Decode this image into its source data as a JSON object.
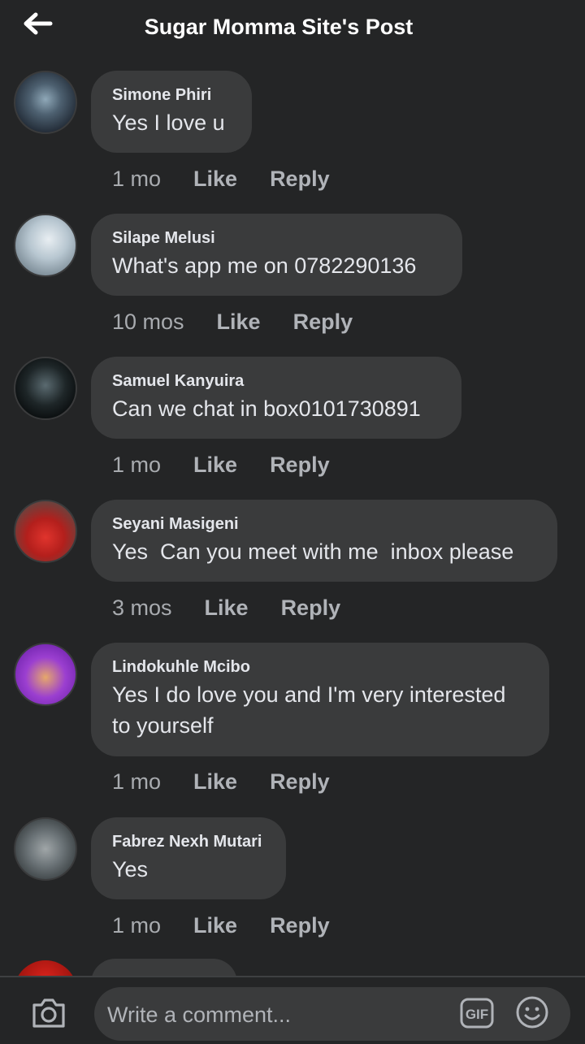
{
  "header": {
    "title": "Sugar Momma Site's Post",
    "back_icon": "arrow-left-icon"
  },
  "comments": [
    {
      "author": "Simone Phiri",
      "text": "Yes I love u",
      "time": "1 mo",
      "like": "Like",
      "reply": "Reply"
    },
    {
      "author": "Silape Melusi",
      "text": "What's app me on 0782290136",
      "time": "10 mos",
      "like": "Like",
      "reply": "Reply"
    },
    {
      "author": "Samuel Kanyuira",
      "text": "Can we chat in box0101730891",
      "time": "1 mo",
      "like": "Like",
      "reply": "Reply"
    },
    {
      "author": "Seyani Masigeni",
      "text": "Yes  Can you meet with me  inbox please",
      "time": "3 mos",
      "like": "Like",
      "reply": "Reply"
    },
    {
      "author": "Lindokuhle Mcibo",
      "text": "Yes I do love you and I'm very interested to yourself",
      "time": "1 mo",
      "like": "Like",
      "reply": "Reply"
    },
    {
      "author": "Fabrez Nexh Mutari",
      "text": "Yes",
      "time": "1 mo",
      "like": "Like",
      "reply": "Reply"
    }
  ],
  "composer": {
    "placeholder": "Write a comment...",
    "camera_icon": "camera-icon",
    "gif_label": "GIF",
    "emoji_icon": "smiley-icon"
  },
  "colors": {
    "background": "#242526",
    "bubble": "#3a3b3c",
    "text": "#e4e6eb",
    "muted": "#b0b3b8"
  }
}
